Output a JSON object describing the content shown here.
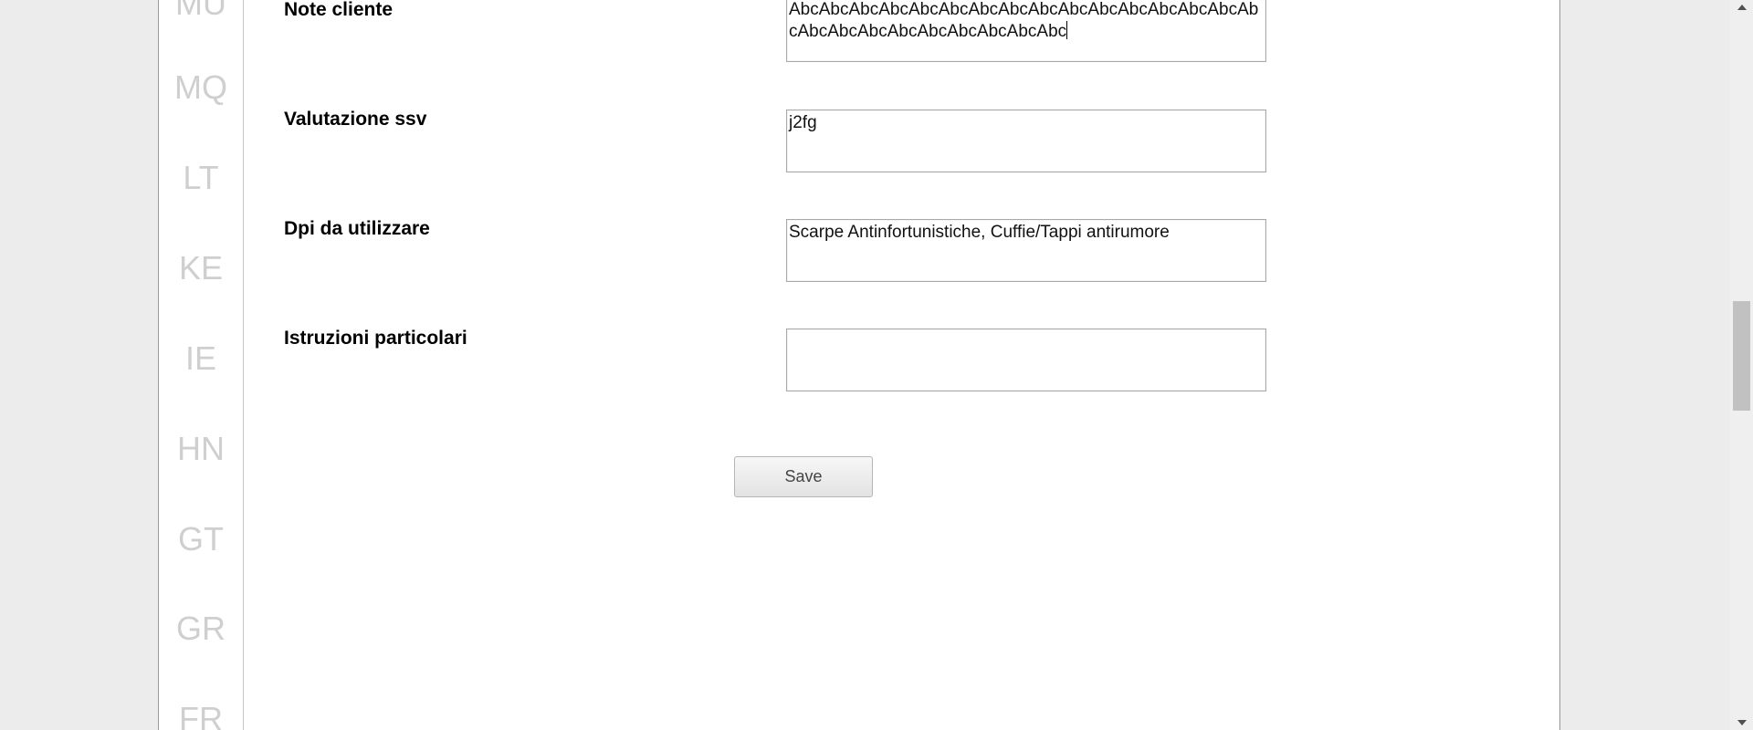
{
  "sidebar": {
    "countries": [
      "MU",
      "MQ",
      "LT",
      "KE",
      "IE",
      "HN",
      "GT",
      "GR",
      "FR"
    ]
  },
  "form": {
    "fields": [
      {
        "label": "Note cliente",
        "value": "AbcAbcAbcAbcAbcAbcAbcAbcAbcAbcAbcAbcAbcAbcAbcAbcAbcAbcAbcAbcAbcAbcAbcAbcAbc"
      },
      {
        "label": "Valutazione ssv",
        "value": "j2fg"
      },
      {
        "label": "Dpi da utilizzare",
        "value": "Scarpe Antinfortunistiche, Cuffie/Tappi antirumore"
      },
      {
        "label": "Istruzioni particolari",
        "value": ""
      }
    ],
    "save_label": "Save"
  },
  "colors": {
    "page_bg": "#ececec",
    "panel_bg": "#ffffff",
    "country_text": "#cfcfcf",
    "scroll_thumb": "#c1c1c1"
  },
  "icons": {
    "scroll_up": "triangle-up-icon",
    "scroll_down": "triangle-down-icon"
  }
}
